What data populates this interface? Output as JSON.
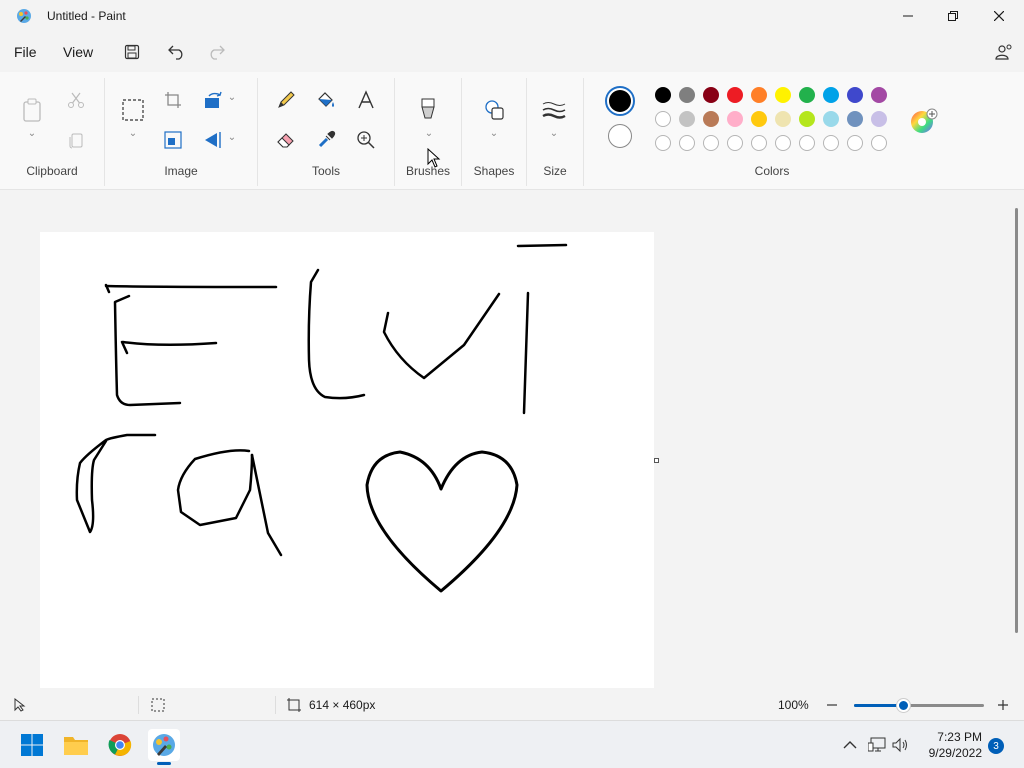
{
  "window": {
    "title": "Untitled - Paint"
  },
  "menu": {
    "file": "File",
    "view": "View"
  },
  "ribbon": {
    "groups": {
      "clipboard": "Clipboard",
      "image": "Image",
      "tools": "Tools",
      "brushes": "Brushes",
      "shapes": "Shapes",
      "size": "Size",
      "colors": "Colors"
    },
    "palette_row1": [
      "#000000",
      "#7f7f7f",
      "#880015",
      "#ed1c24",
      "#ff7f27",
      "#fff200",
      "#22b14c",
      "#00a2e8",
      "#3f48cc",
      "#a349a4"
    ],
    "palette_row2": [
      "#ffffff",
      "#c3c3c3",
      "#b97a57",
      "#ffaec9",
      "#ffc90e",
      "#efe4b0",
      "#b5e61d",
      "#99d9ea",
      "#7092be",
      "#c8bfe7"
    ],
    "primary_color": "#000000",
    "secondary_color": "#ffffff"
  },
  "status": {
    "canvas_size": "614 × 460px",
    "zoom": "100%",
    "zoom_level": 0.38
  },
  "taskbar": {
    "time": "7:23 PM",
    "date": "9/29/2022",
    "notifications": "3"
  }
}
